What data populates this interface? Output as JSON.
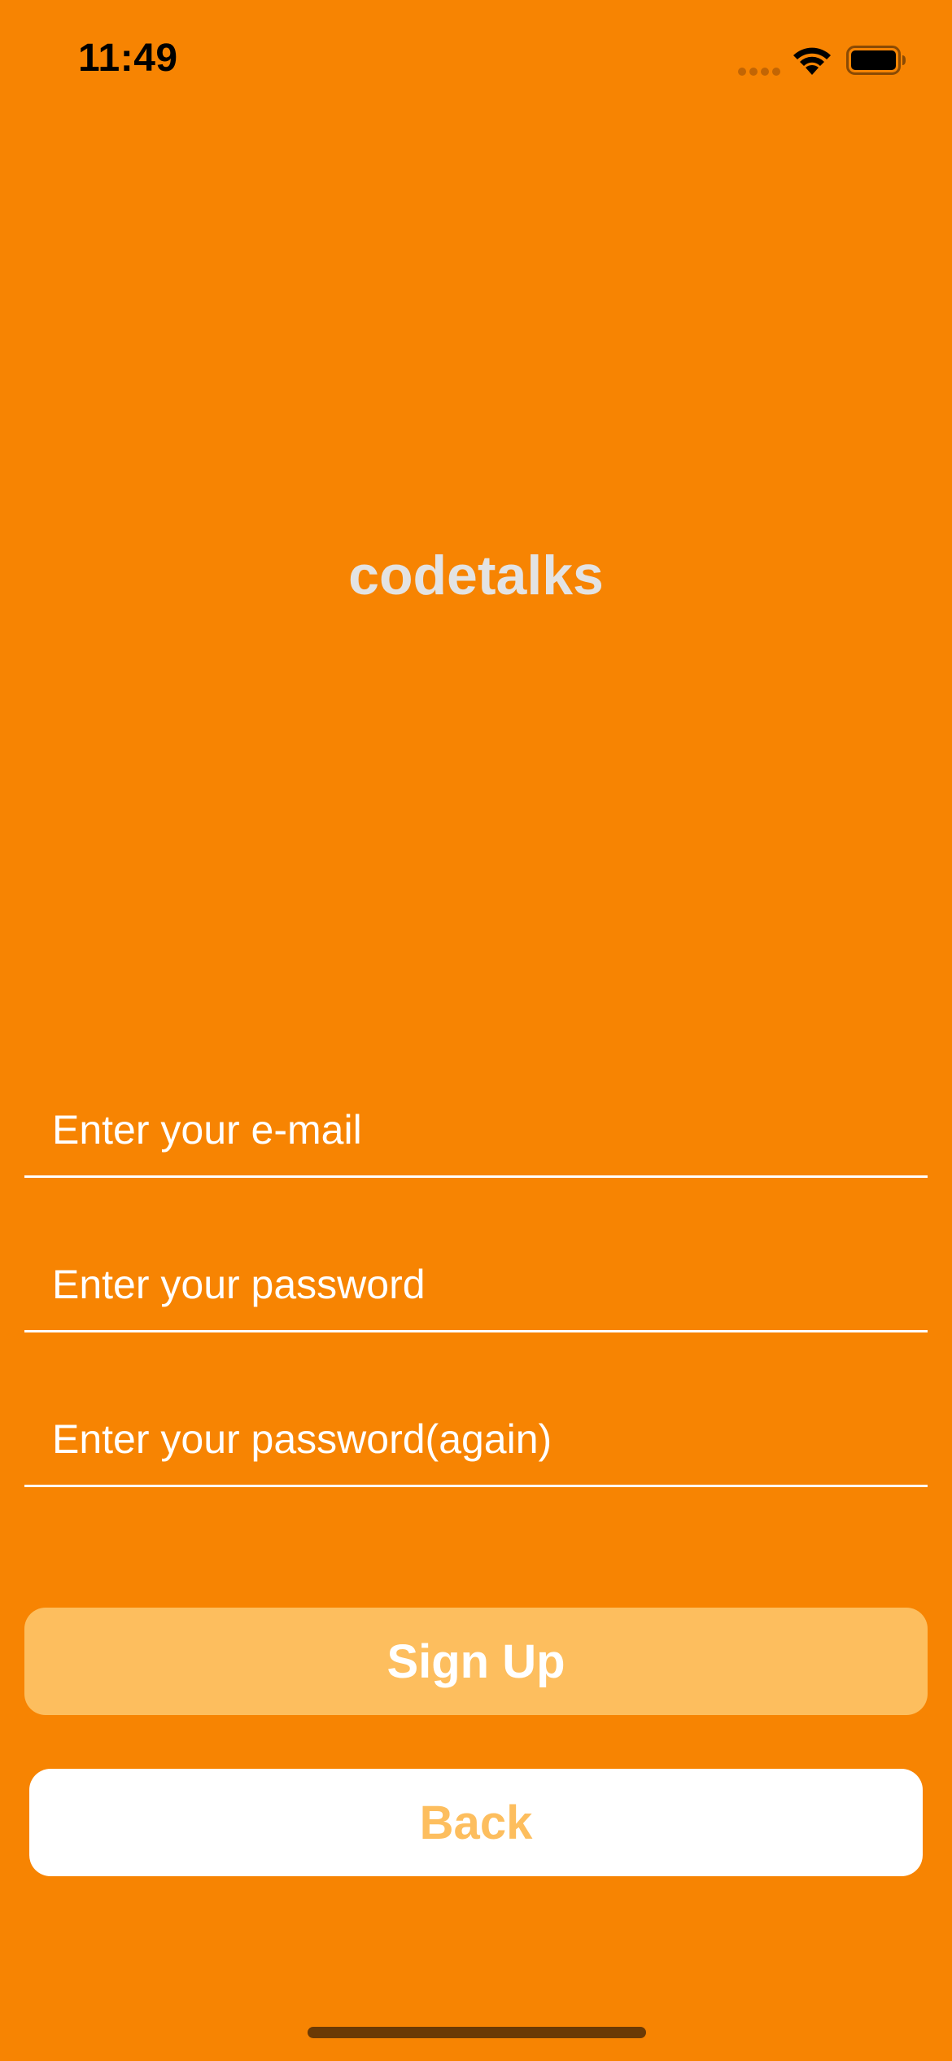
{
  "status_bar": {
    "time": "11:49",
    "icons": [
      "signal-icon",
      "wifi-icon",
      "battery-icon"
    ]
  },
  "app": {
    "title": "codetalks"
  },
  "form": {
    "email_placeholder": "Enter your e-mail",
    "password_placeholder": "Enter your password",
    "password_again_placeholder": "Enter your password(again)"
  },
  "buttons": {
    "signup_label": "Sign Up",
    "back_label": "Back"
  },
  "colors": {
    "background": "#F78402",
    "signup_button": "#FDBE5E",
    "back_button": "#FFFFFF",
    "title_text": "#E3E3E3"
  }
}
